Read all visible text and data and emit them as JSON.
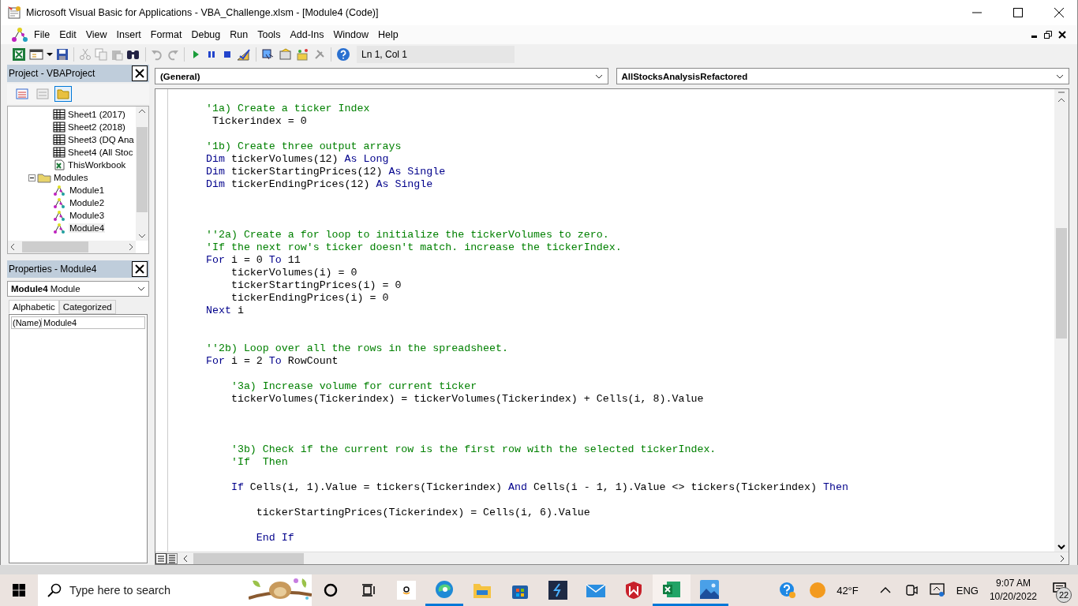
{
  "window": {
    "title": "Microsoft Visual Basic for Applications - VBA_Challenge.xlsm - [Module4 (Code)]"
  },
  "menu": [
    "File",
    "Edit",
    "View",
    "Insert",
    "Format",
    "Debug",
    "Run",
    "Tools",
    "Add-Ins",
    "Window",
    "Help"
  ],
  "toolbar": {
    "position": "Ln 1, Col 1"
  },
  "project": {
    "title": "Project - VBAProject",
    "continued_items": [
      {
        "label": "Sheet1 (2017)",
        "kind": "sheet",
        "selected": false
      },
      {
        "label": "Sheet2 (2018)",
        "kind": "sheet",
        "selected": false
      },
      {
        "label": "Sheet3 (DQ Ana",
        "kind": "sheet",
        "selected": false
      },
      {
        "label": "Sheet4 (All Stoc",
        "kind": "sheet",
        "selected": false
      },
      {
        "label": "ThisWorkbook",
        "kind": "workbook",
        "selected": false
      }
    ],
    "items": [
      {
        "label": "Modules",
        "kind": "folder",
        "expanded": true,
        "selected": false,
        "children": [
          {
            "label": "Module1",
            "kind": "module",
            "selected": false
          },
          {
            "label": "Module2",
            "kind": "module",
            "selected": false
          },
          {
            "label": "Module3",
            "kind": "module",
            "selected": false
          },
          {
            "label": "Module4",
            "kind": "module",
            "selected": true
          }
        ]
      }
    ]
  },
  "properties": {
    "title": "Properties - Module4",
    "object": "**Module4** Module",
    "tabs": [
      {
        "label": "Alphabetic",
        "selected": true
      },
      {
        "label": "Categorized",
        "selected": false
      }
    ],
    "rows": [
      {
        "name": "(Name)",
        "value": "Module4"
      }
    ]
  },
  "code": {
    "object": "(General)",
    "procedure": "AllStocksAnalysisRefactored",
    "lines": [
      {
        "kind": "comment",
        "segments": [
          {
            "kind": "comment",
            "text": "'1a) Create a ticker Index"
          }
        ]
      },
      {
        "kind": "code",
        "segments": [
          {
            "kind": "plain",
            "text": " Tickerindex = 0"
          }
        ]
      },
      {
        "kind": "blank"
      },
      {
        "kind": "comment",
        "segments": [
          {
            "kind": "comment",
            "text": "'1b) Create three output arrays"
          }
        ]
      },
      {
        "kind": "code",
        "segments": [
          {
            "kind": "keyword",
            "text": "Dim"
          },
          {
            "kind": "plain",
            "text": " tickerVolumes(12) "
          },
          {
            "kind": "keyword",
            "text": "As Long"
          }
        ]
      },
      {
        "kind": "code",
        "segments": [
          {
            "kind": "keyword",
            "text": "Dim"
          },
          {
            "kind": "plain",
            "text": " tickerStartingPrices(12) "
          },
          {
            "kind": "keyword",
            "text": "As Single"
          }
        ]
      },
      {
        "kind": "code",
        "segments": [
          {
            "kind": "keyword",
            "text": "Dim"
          },
          {
            "kind": "plain",
            "text": " tickerEndingPrices(12) "
          },
          {
            "kind": "keyword",
            "text": "As Single"
          }
        ]
      },
      {
        "kind": "blank"
      },
      {
        "kind": "blank"
      },
      {
        "kind": "blank"
      },
      {
        "kind": "comment",
        "segments": [
          {
            "kind": "comment",
            "text": "''2a) Create a for loop to initialize the tickerVolumes to zero."
          }
        ]
      },
      {
        "kind": "comment",
        "segments": [
          {
            "kind": "comment",
            "text": "'If the next row's ticker doesn't match. increase the tickerIndex."
          }
        ]
      },
      {
        "kind": "code",
        "segments": [
          {
            "kind": "keyword",
            "text": "For"
          },
          {
            "kind": "plain",
            "text": " i = 0 "
          },
          {
            "kind": "keyword",
            "text": "To"
          },
          {
            "kind": "plain",
            "text": " 11"
          }
        ]
      },
      {
        "kind": "code",
        "segments": [
          {
            "kind": "plain",
            "text": "    tickerVolumes(i) = 0"
          }
        ]
      },
      {
        "kind": "code",
        "segments": [
          {
            "kind": "plain",
            "text": "    tickerStartingPrices(i) = 0"
          }
        ]
      },
      {
        "kind": "code",
        "segments": [
          {
            "kind": "plain",
            "text": "    tickerEndingPrices(i) = 0"
          }
        ]
      },
      {
        "kind": "code",
        "segments": [
          {
            "kind": "keyword",
            "text": "Next"
          },
          {
            "kind": "plain",
            "text": " i"
          }
        ]
      },
      {
        "kind": "blank"
      },
      {
        "kind": "blank"
      },
      {
        "kind": "comment",
        "segments": [
          {
            "kind": "comment",
            "text": "''2b) Loop over all the rows in the spreadsheet."
          }
        ]
      },
      {
        "kind": "code",
        "segments": [
          {
            "kind": "keyword",
            "text": "For"
          },
          {
            "kind": "plain",
            "text": " i = 2 "
          },
          {
            "kind": "keyword",
            "text": "To"
          },
          {
            "kind": "plain",
            "text": " RowCount"
          }
        ]
      },
      {
        "kind": "blank"
      },
      {
        "kind": "comment",
        "segments": [
          {
            "kind": "comment",
            "text": "    '3a) Increase volume for current ticker"
          }
        ]
      },
      {
        "kind": "code",
        "segments": [
          {
            "kind": "plain",
            "text": "    tickerVolumes(Tickerindex) = tickerVolumes(Tickerindex) + Cells(i, 8).Value"
          }
        ]
      },
      {
        "kind": "blank"
      },
      {
        "kind": "blank"
      },
      {
        "kind": "blank"
      },
      {
        "kind": "comment",
        "segments": [
          {
            "kind": "comment",
            "text": "    '3b) Check if the current row is the first row with the selected tickerIndex."
          }
        ]
      },
      {
        "kind": "comment",
        "segments": [
          {
            "kind": "comment",
            "text": "    'If  Then"
          }
        ]
      },
      {
        "kind": "blank"
      },
      {
        "kind": "code",
        "segments": [
          {
            "kind": "keyword",
            "text": "    If"
          },
          {
            "kind": "plain",
            "text": " Cells(i, 1).Value = tickers(Tickerindex) "
          },
          {
            "kind": "keyword",
            "text": "And"
          },
          {
            "kind": "plain",
            "text": " Cells(i - 1, 1).Value <> tickers(Tickerindex) "
          },
          {
            "kind": "keyword",
            "text": "Then"
          }
        ]
      },
      {
        "kind": "blank"
      },
      {
        "kind": "code",
        "segments": [
          {
            "kind": "plain",
            "text": "        tickerStartingPrices(Tickerindex) = Cells(i, 6).Value"
          }
        ]
      },
      {
        "kind": "blank"
      },
      {
        "kind": "code",
        "segments": [
          {
            "kind": "keyword",
            "text": "        End If"
          }
        ]
      }
    ]
  },
  "taskbar": {
    "search": {
      "placeholder": "Type here to search"
    },
    "temperature": "42°F",
    "language": "ENG",
    "time": "9:07 AM",
    "date": "10/20/2022",
    "notifications": "22"
  }
}
